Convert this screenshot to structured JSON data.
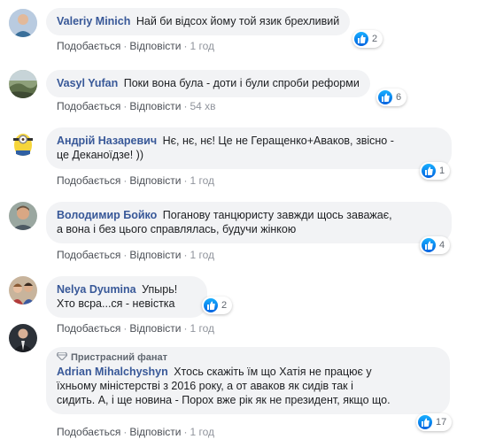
{
  "actions": {
    "like": "Подобається",
    "reply": "Відповісти",
    "separator": "·"
  },
  "colors": {
    "author": "#385898",
    "bubble": "#f2f3f5",
    "like_blue": "#1877f2"
  },
  "comments": [
    {
      "author": "Valeriy Minich",
      "text": "Най би відсох йому той язик брехливий",
      "time": "1 год",
      "reactions": "2",
      "avatar_icon": "man-icon"
    },
    {
      "author": "Vasyl Yufan",
      "text": "Поки вона була - доти і були спроби реформи",
      "time": "54 хв",
      "reactions": "6",
      "avatar_icon": "landscape-icon"
    },
    {
      "author": "Андрій Назаревич",
      "text_line1": "Нє, нє, нє! Це не Геращенко+Аваков, звісно -",
      "text_line2": "це Деканоїдзе! ))",
      "time": "1 год",
      "reactions": "1",
      "avatar_icon": "minion-icon"
    },
    {
      "author": "Володимир Бойко",
      "text_line1": "Поганову танцюристу завжди щось заважає,",
      "text_line2": "а вона і без цього справлялась, будучи жінкою",
      "time": "1 год",
      "reactions": "4",
      "avatar_icon": "man-icon"
    },
    {
      "author": "Nelya Dyumina",
      "text_line1": "Упырь!",
      "text_line2": "Хто всра...ся - невістка",
      "time": "1 год",
      "reactions": "2",
      "avatar_icon": "group-photo-icon"
    },
    {
      "badge": "Пристрасний фанат",
      "author": "Adrian Mihalchyshyn",
      "text_line1": "Хтось скажіть їм що Хатія не працює у",
      "text_line2": "їхньому міністерстві з 2016 року, а от аваков як сидів так і",
      "text_line3": "сидить. А, і ще новина - Порох вже рік як не президент, якщо що.",
      "time": "1 год",
      "reactions": "17",
      "avatar_icon": "man-in-suit-icon"
    }
  ]
}
